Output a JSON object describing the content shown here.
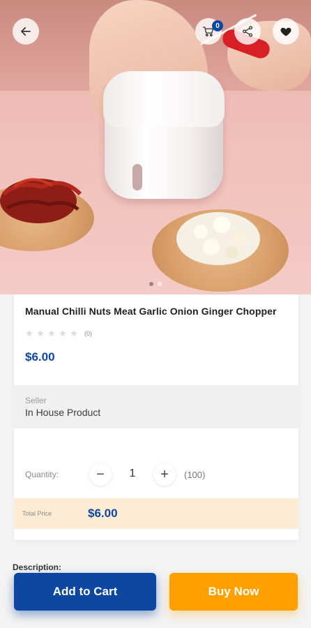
{
  "header": {
    "cart_count": "0"
  },
  "icons": {
    "back": "arrow-left-icon",
    "cart": "shopping-cart-icon",
    "share": "share-icon",
    "wishlist": "heart-icon"
  },
  "product": {
    "title": "Manual Chilli Nuts Meat Garlic Onion Ginger Chopper",
    "rating_count": "(0)",
    "rating_value": 0,
    "rating_max": 5,
    "price": "$6.00",
    "image_index": 0,
    "image_count": 2
  },
  "seller": {
    "label": "Seller",
    "value": "In House Product"
  },
  "quantity": {
    "label": "Quantity:",
    "minus": "−",
    "value": "1",
    "plus": "+",
    "stock": "(100)"
  },
  "total": {
    "label": "Total Price",
    "value": "$6.00"
  },
  "description": {
    "heading": "Description:"
  },
  "actions": {
    "add_to_cart": "Add to Cart",
    "buy_now": "Buy Now"
  },
  "colors": {
    "primary": "#0d47a1",
    "accent": "#ffa000",
    "total_bg": "#fdebd3"
  }
}
